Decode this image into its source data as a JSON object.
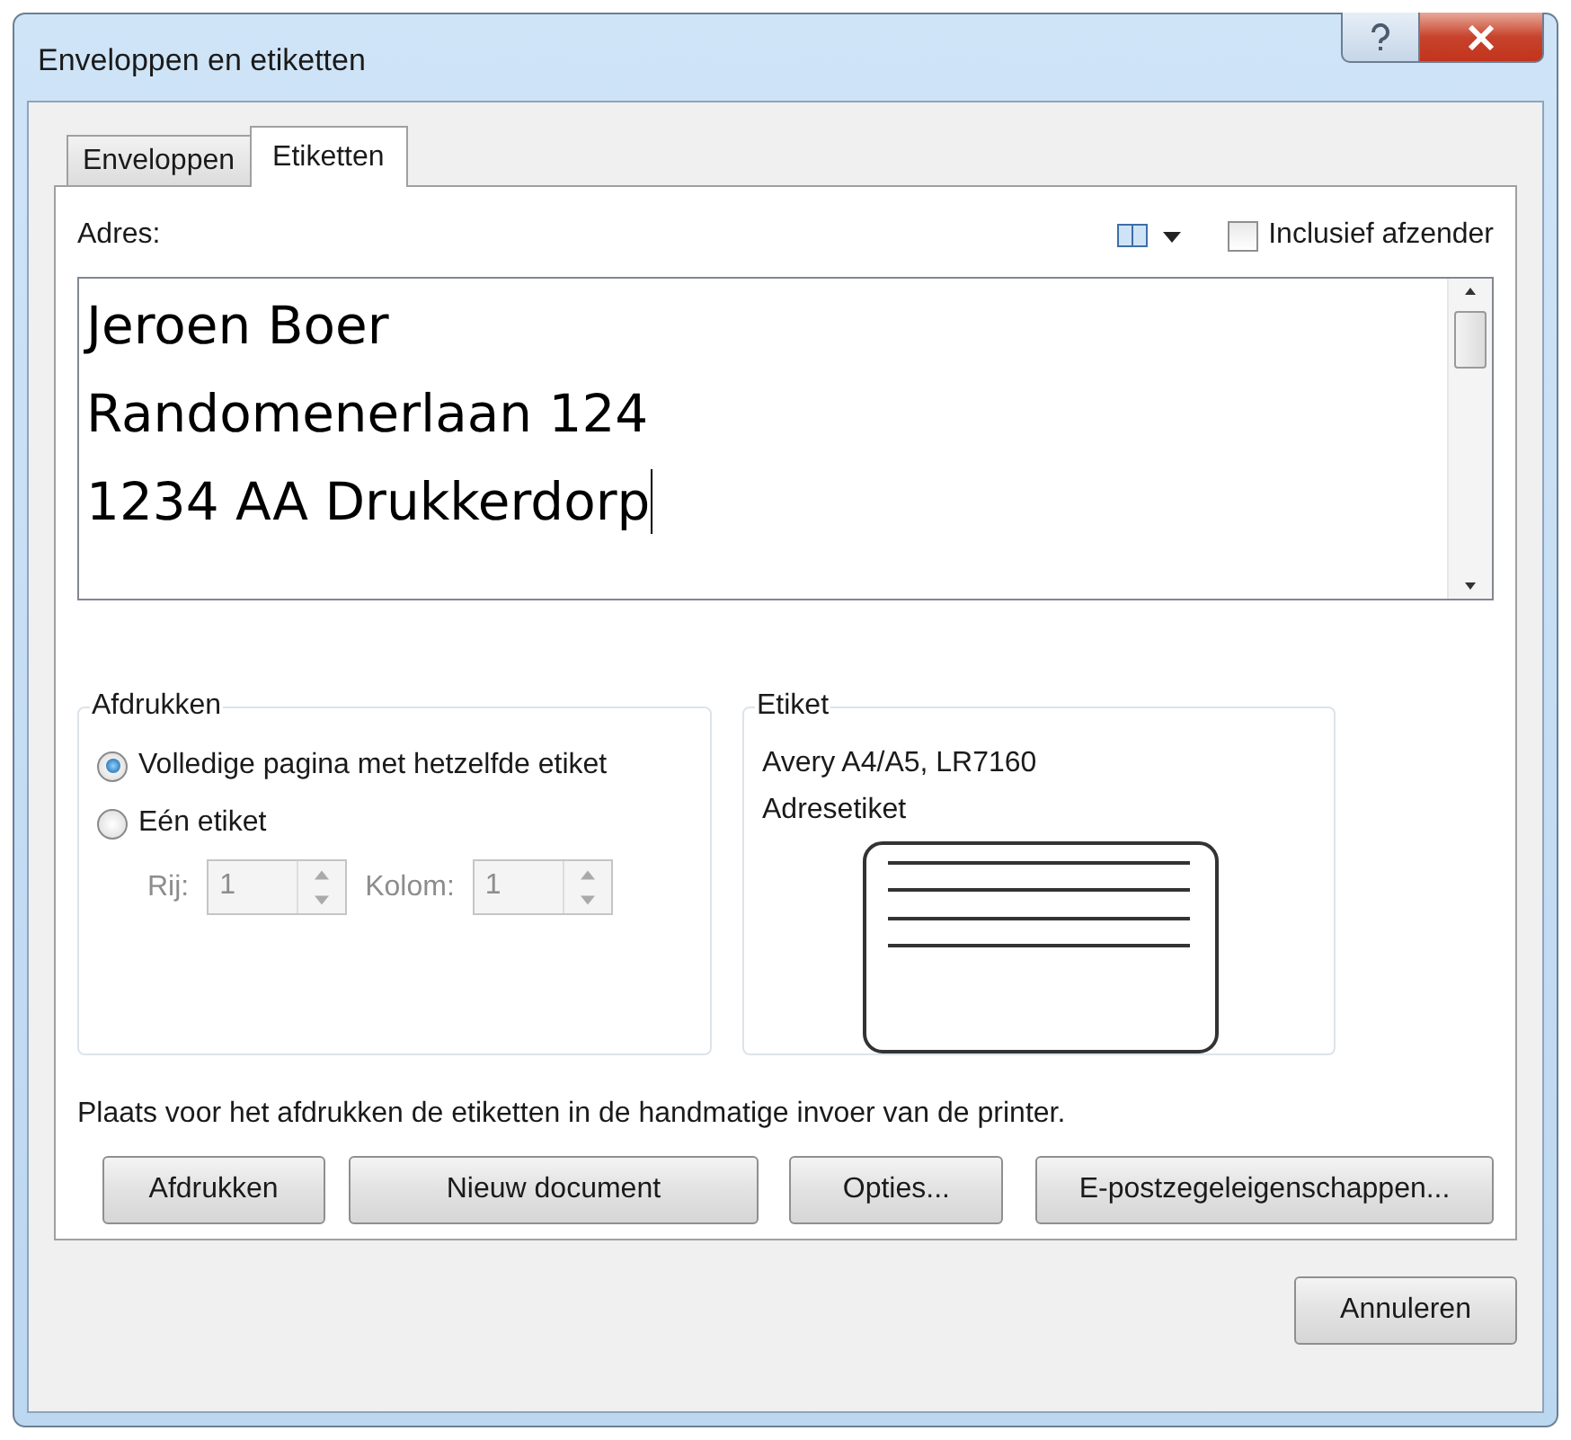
{
  "window": {
    "title": "Enveloppen en etiketten"
  },
  "tabs": [
    {
      "label": "Enveloppen",
      "selected": false
    },
    {
      "label": "Etiketten",
      "selected": true
    }
  ],
  "address": {
    "label": "Adres:",
    "lines": [
      "Jeroen Boer",
      "Randomenerlaan 124",
      "1234 AA Drukkerdorp"
    ],
    "include_sender": {
      "label": "Inclusief afzender",
      "checked": false
    }
  },
  "print_group": {
    "title": "Afdrukken",
    "options": [
      {
        "label": "Volledige pagina met hetzelfde etiket",
        "selected": true
      },
      {
        "label": "Eén etiket",
        "selected": false
      }
    ],
    "spinners": [
      {
        "label": "Rij:",
        "value": "1",
        "disabled": true
      },
      {
        "label": "Kolom:",
        "value": "1",
        "disabled": true
      }
    ]
  },
  "label_group": {
    "title": "Etiket",
    "lines": [
      "Avery A4/A5, LR7160",
      "Adresetiket"
    ]
  },
  "note": "Plaats voor het afdrukken de etiketten in de handmatige invoer van de printer.",
  "action_buttons": [
    "Afdrukken",
    "Nieuw document",
    "Opties...",
    "E-postzegeleigenschappen..."
  ],
  "cancel_button": "Annuleren"
}
